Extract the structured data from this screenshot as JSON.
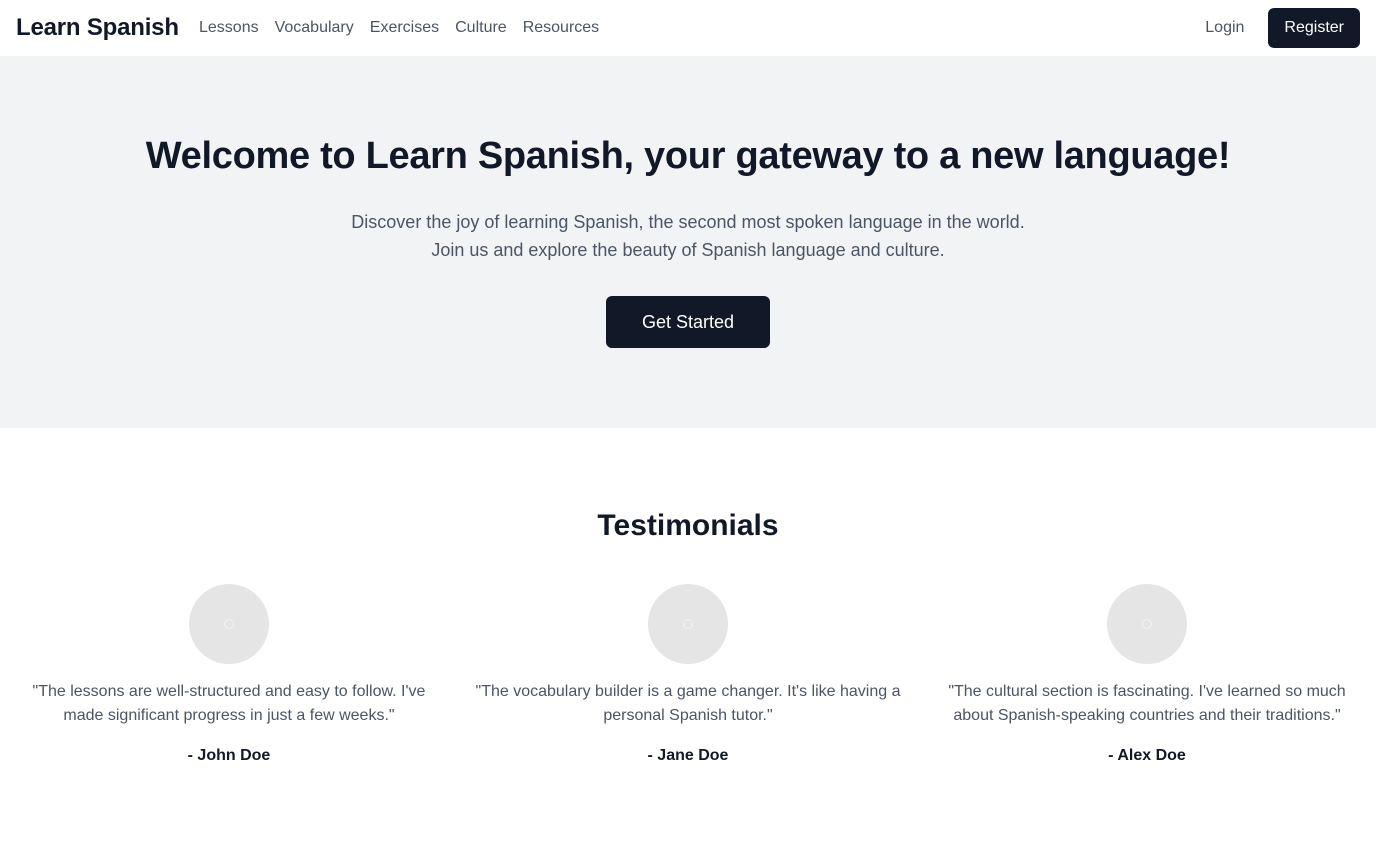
{
  "header": {
    "brand": "Learn Spanish",
    "nav": [
      "Lessons",
      "Vocabulary",
      "Exercises",
      "Culture",
      "Resources"
    ],
    "login_label": "Login",
    "register_label": "Register"
  },
  "hero": {
    "title": "Welcome to Learn Spanish, your gateway to a new language!",
    "text": "Discover the joy of learning Spanish, the second most spoken language in the world. Join us and explore the beauty of Spanish language and culture.",
    "cta_label": "Get Started"
  },
  "testimonials": {
    "title": "Testimonials",
    "items": [
      {
        "quote": "\"The lessons are well-structured and easy to follow. I've made significant progress in just a few weeks.\"",
        "author": "- John Doe"
      },
      {
        "quote": "\"The vocabulary builder is a game changer. It's like having a personal Spanish tutor.\"",
        "author": "- Jane Doe"
      },
      {
        "quote": "\"The cultural section is fascinating. I've learned so much about Spanish-speaking countries and their traditions.\"",
        "author": "- Alex Doe"
      }
    ]
  },
  "colors": {
    "primary": "#111827",
    "hero_background": "#f2f3f5",
    "muted_text": "#4b5563",
    "avatar_placeholder": "#e5e5e5"
  }
}
